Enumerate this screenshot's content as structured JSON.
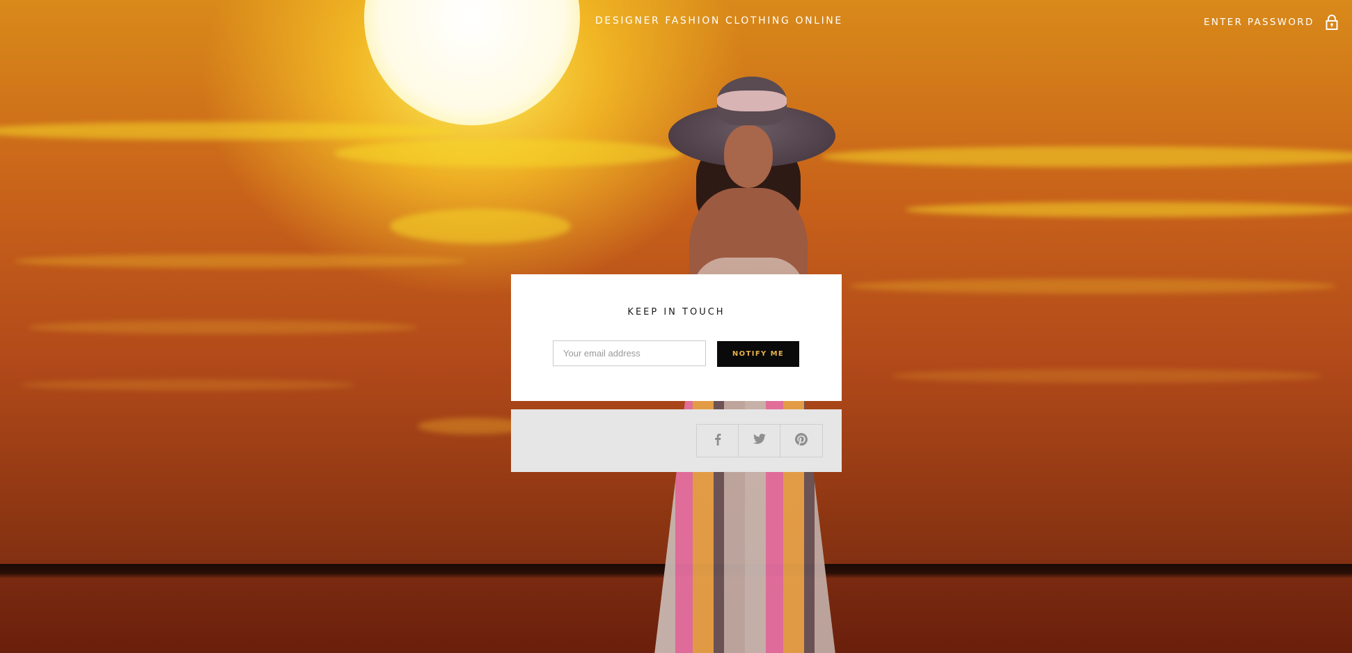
{
  "header": {
    "title": "DESIGNER FASHION CLOTHING ONLINE",
    "password_label": "ENTER PASSWORD",
    "password_icon": "lock-icon"
  },
  "newsletter": {
    "heading": "KEEP IN TOUCH",
    "email_placeholder": "Your email address",
    "email_value": "",
    "button_label": "NOTIFY ME"
  },
  "social": {
    "icons": [
      "facebook-icon",
      "twitter-icon",
      "pinterest-icon"
    ]
  },
  "colors": {
    "card_background": "#ffffff",
    "social_bar_background": "#e6e6e6",
    "button_background": "#0a0a0a",
    "button_text": "#e8b24a",
    "header_text": "#ffffff"
  }
}
